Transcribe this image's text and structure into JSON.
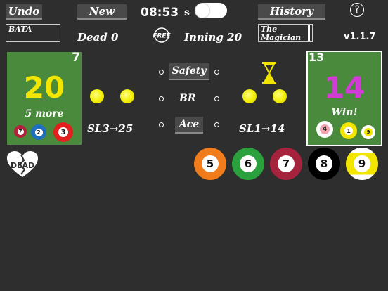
{
  "toolbar": {
    "undo_label": "Undo",
    "new_label": "New",
    "clock": "08:53",
    "seconds_label": "s",
    "history_label": "History",
    "help_label": "?"
  },
  "status": {
    "player1_name": "BATA",
    "dead_label": "Dead 0",
    "free_label": "FREE",
    "inning_label": "Inning 20",
    "player2_name": "The Magician",
    "version": "v1.1.7"
  },
  "player1": {
    "corner_number": "7",
    "score": "20",
    "remaining": "5 more",
    "balls": [
      "7",
      "2",
      "3"
    ],
    "skill": "SL3→25"
  },
  "player2": {
    "corner_number": "13",
    "score": "14",
    "remaining": "Win!",
    "balls": [
      "4",
      "1",
      "9"
    ],
    "skill": "SL1→14"
  },
  "center": {
    "safety_label": "Safety",
    "br_label": "BR",
    "ace_label": "Ace"
  },
  "dead_icon_label": "DEAD",
  "rack": [
    "5",
    "6",
    "7",
    "8",
    "9"
  ],
  "colors": {
    "background": "#2e2e2e",
    "panel_green": "#4a8a3c",
    "score_yellow": "#f2e600",
    "score_magenta": "#d33bd6"
  }
}
